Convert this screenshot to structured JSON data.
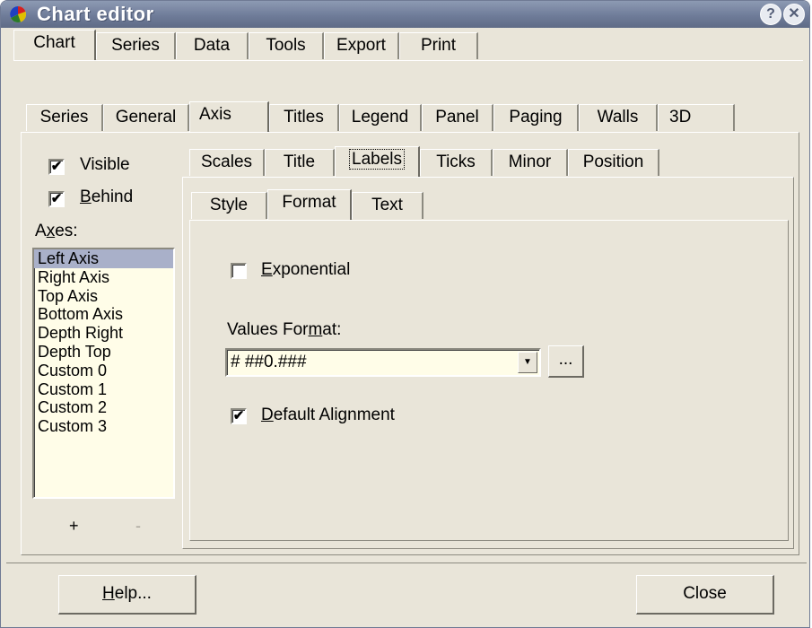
{
  "window": {
    "title": "Chart editor",
    "help_glyph": "?",
    "close_glyph": "✕"
  },
  "top_tabs": [
    "Chart",
    "Series",
    "Data",
    "Tools",
    "Export",
    "Print"
  ],
  "chart_tabs": [
    "Series",
    "General",
    "Axis",
    "Titles",
    "Legend",
    "Panel",
    "Paging",
    "Walls",
    "3D"
  ],
  "axis_tabs": [
    "Scales",
    "Title",
    "Labels",
    "Ticks",
    "Minor",
    "Position"
  ],
  "label_tabs": [
    "Style",
    "Format",
    "Text"
  ],
  "left": {
    "visible_label": "Visible",
    "visible_checked": true,
    "behind_prefix": "",
    "behind_mnemonic": "B",
    "behind_rest": "ehind",
    "behind_checked": true,
    "axes_prefix": "A",
    "axes_mnemonic": "x",
    "axes_rest": "es:",
    "axes": [
      "Left Axis",
      "Right Axis",
      "Top Axis",
      "Bottom Axis",
      "Depth Right",
      "Depth Top",
      "Custom 0",
      "Custom 1",
      "Custom 2",
      "Custom 3"
    ],
    "selected_axis": "Left Axis",
    "add_label": "+",
    "remove_label": "-"
  },
  "format": {
    "exponential_mnemonic": "E",
    "exponential_rest": "xponential",
    "exponential_checked": false,
    "values_format_prefix": "Values For",
    "values_format_mnemonic": "m",
    "values_format_rest": "at:",
    "values_format_value": "# ##0.###",
    "ellipsis_label": "...",
    "default_alignment_mnemonic": "D",
    "default_alignment_rest": "efault Alignment",
    "default_alignment_checked": true
  },
  "footer": {
    "help_mnemonic": "H",
    "help_rest": "elp...",
    "close_label": "Close"
  },
  "colors": {
    "face": "#e9e5d9",
    "title_bar": "#6f7c99",
    "list_bg": "#fffde8",
    "selection": "#a9b0c9"
  }
}
